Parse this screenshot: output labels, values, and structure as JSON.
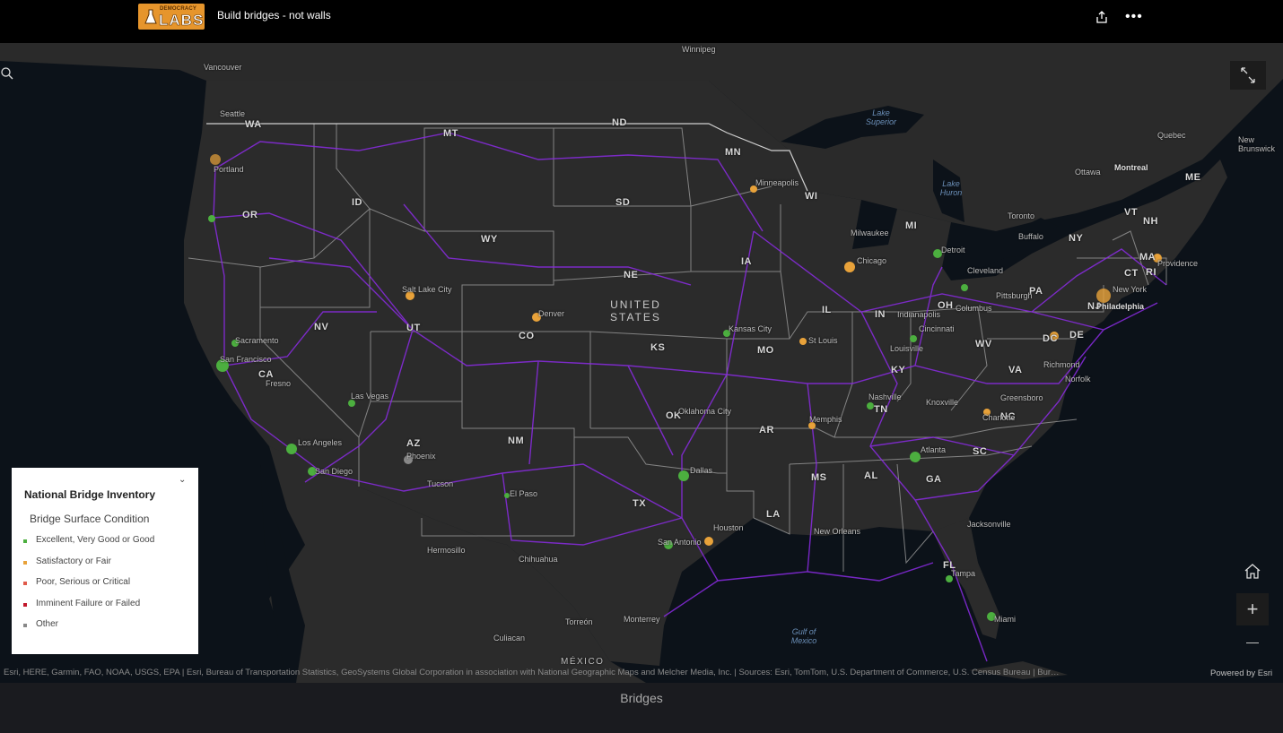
{
  "header": {
    "logo_small": "DEMOCRACY",
    "logo_big": "LABS",
    "title": "Build bridges - not walls",
    "share_icon": "share-icon",
    "more_icon": "more-icon"
  },
  "map": {
    "country_label": [
      "UNITED",
      "STATES"
    ],
    "states": [
      {
        "t": "WA"
      },
      {
        "t": "OR"
      },
      {
        "t": "CA"
      },
      {
        "t": "NV"
      },
      {
        "t": "ID"
      },
      {
        "t": "MT"
      },
      {
        "t": "WY"
      },
      {
        "t": "UT"
      },
      {
        "t": "AZ"
      },
      {
        "t": "CO"
      },
      {
        "t": "NM"
      },
      {
        "t": "ND"
      },
      {
        "t": "SD"
      },
      {
        "t": "NE"
      },
      {
        "t": "KS"
      },
      {
        "t": "OK"
      },
      {
        "t": "TX"
      },
      {
        "t": "MN"
      },
      {
        "t": "IA"
      },
      {
        "t": "MO"
      },
      {
        "t": "AR"
      },
      {
        "t": "LA"
      },
      {
        "t": "WI"
      },
      {
        "t": "IL"
      },
      {
        "t": "MS"
      },
      {
        "t": "MI"
      },
      {
        "t": "IN"
      },
      {
        "t": "KY"
      },
      {
        "t": "TN"
      },
      {
        "t": "AL"
      },
      {
        "t": "GA"
      },
      {
        "t": "FL"
      },
      {
        "t": "OH"
      },
      {
        "t": "WV"
      },
      {
        "t": "VA"
      },
      {
        "t": "NC"
      },
      {
        "t": "SC"
      },
      {
        "t": "PA"
      },
      {
        "t": "NY"
      },
      {
        "t": "VT"
      },
      {
        "t": "NH"
      },
      {
        "t": "ME"
      },
      {
        "t": "MA"
      },
      {
        "t": "CT"
      },
      {
        "t": "RI"
      },
      {
        "t": "NJ"
      },
      {
        "t": "DE"
      },
      {
        "t": "DC"
      }
    ],
    "places": [
      {
        "t": "Winnipeg"
      },
      {
        "t": "Vancouver"
      },
      {
        "t": "Seattle"
      },
      {
        "t": "Portland"
      },
      {
        "t": "Sacramento"
      },
      {
        "t": "San Francisco"
      },
      {
        "t": "Fresno"
      },
      {
        "t": "Los Angeles"
      },
      {
        "t": "San Diego"
      },
      {
        "t": "Las Vegas"
      },
      {
        "t": "Salt Lake City"
      },
      {
        "t": "Phoenix"
      },
      {
        "t": "Tucson"
      },
      {
        "t": "El Paso"
      },
      {
        "t": "Denver"
      },
      {
        "t": "Minneapolis"
      },
      {
        "t": "Milwaukee"
      },
      {
        "t": "Chicago"
      },
      {
        "t": "Detroit"
      },
      {
        "t": "Kansas City"
      },
      {
        "t": "St Louis"
      },
      {
        "t": "Indianapolis"
      },
      {
        "t": "Cincinnati"
      },
      {
        "t": "Columbus"
      },
      {
        "t": "Cleveland"
      },
      {
        "t": "Pittsburgh"
      },
      {
        "t": "Philadelphia"
      },
      {
        "t": "New York"
      },
      {
        "t": "Buffalo"
      },
      {
        "t": "Toronto"
      },
      {
        "t": "Ottawa"
      },
      {
        "t": "Montreal"
      },
      {
        "t": "Quebec"
      },
      {
        "t": "New Brunswick"
      },
      {
        "t": "Providence"
      },
      {
        "t": "Louisville"
      },
      {
        "t": "Nashville"
      },
      {
        "t": "Memphis"
      },
      {
        "t": "Knoxville"
      },
      {
        "t": "Charlotte"
      },
      {
        "t": "Greensboro"
      },
      {
        "t": "Atlanta"
      },
      {
        "t": "Jacksonville"
      },
      {
        "t": "Tampa"
      },
      {
        "t": "Miami"
      },
      {
        "t": "New Orleans"
      },
      {
        "t": "Dallas"
      },
      {
        "t": "Oklahoma City"
      },
      {
        "t": "San Antonio"
      },
      {
        "t": "Houston"
      },
      {
        "t": "Richmond"
      },
      {
        "t": "Norfolk"
      },
      {
        "t": "Hermosillo"
      },
      {
        "t": "Chihuahua"
      },
      {
        "t": "Torreón"
      },
      {
        "t": "Monterrey"
      },
      {
        "t": "Culiacan"
      }
    ],
    "waters": [
      {
        "t": "Lake Superior"
      },
      {
        "t": "Lake Huron"
      },
      {
        "t": "Gulf of Mexico"
      }
    ],
    "mexico_label": "MÉXICO",
    "search_icon": "search-icon",
    "expand_icon": "expand-icon",
    "home_icon": "home-icon",
    "zoom_in": "+",
    "zoom_out": "—"
  },
  "legend": {
    "title": "National Bridge Inventory",
    "subtitle": "Bridge Surface Condition",
    "items": [
      {
        "label": "Excellent, Very Good or Good",
        "color": "#4caf3f"
      },
      {
        "label": "Satisfactory or Fair",
        "color": "#e8a23a"
      },
      {
        "label": "Poor, Serious or Critical",
        "color": "#e05a4a"
      },
      {
        "label": "Imminent Failure or Failed",
        "color": "#c2182b"
      },
      {
        "label": "Other",
        "color": "#888888"
      }
    ]
  },
  "colors": {
    "roads": "#8a2be2",
    "borders": "#a0a0a0",
    "land": "#2b2b2b",
    "water": "#0c1219"
  },
  "attribution": "Esri, HERE, Garmin, FAO, NOAA, USGS, EPA | Esri, Bureau of Transportation Statistics, GeoSystems Global Corporation in association with National Geographic Maps and Melcher Media, Inc. | Sources: Esri, TomTom, U.S. Department of Commerce, U.S. Census Bureau | Bur…",
  "powered_by": "Powered by Esri",
  "footer": {
    "tab": "Bridges"
  }
}
